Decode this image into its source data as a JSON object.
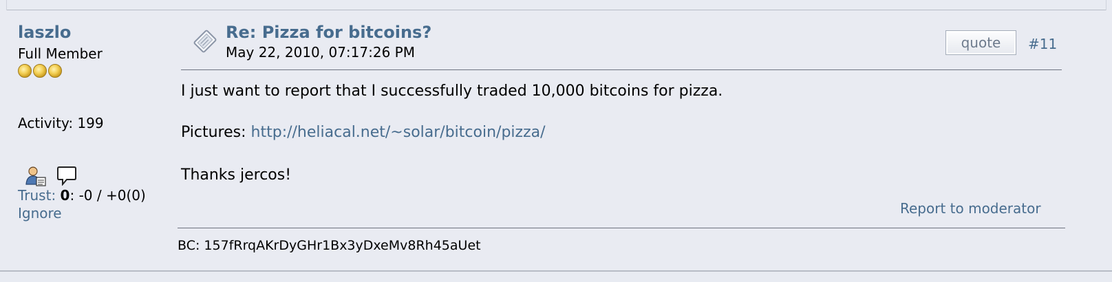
{
  "poster": {
    "name": "laszlo",
    "rank": "Full Member",
    "activity": "Activity: 199",
    "trust_label": "Trust:",
    "trust_score": "0",
    "trust_detail": ": -0 / +0(0)",
    "ignore_label": "Ignore",
    "stars": 3
  },
  "post": {
    "subject": "Re: Pizza for bitcoins?",
    "date": "May 22, 2010, 07:17:26 PM",
    "quote_label": "quote",
    "number": "#11",
    "body_line1": "I just want to report that I successfully traded 10,000 bitcoins for pizza.",
    "pictures_label": "Pictures: ",
    "pictures_link": "http://heliacal.net/~solar/bitcoin/pizza/",
    "body_line3": "Thanks jercos!",
    "report_label": "Report to moderator",
    "signature": "BC: 157fRrqAKrDyGHr1Bx3yDxeMv8Rh45aUet"
  },
  "colors": {
    "link": "#476c8e",
    "background": "#e9ebf2",
    "separator": "#6e7380"
  },
  "icons": [
    "star-icon",
    "profile-icon",
    "pm-icon",
    "post-xx-icon"
  ]
}
